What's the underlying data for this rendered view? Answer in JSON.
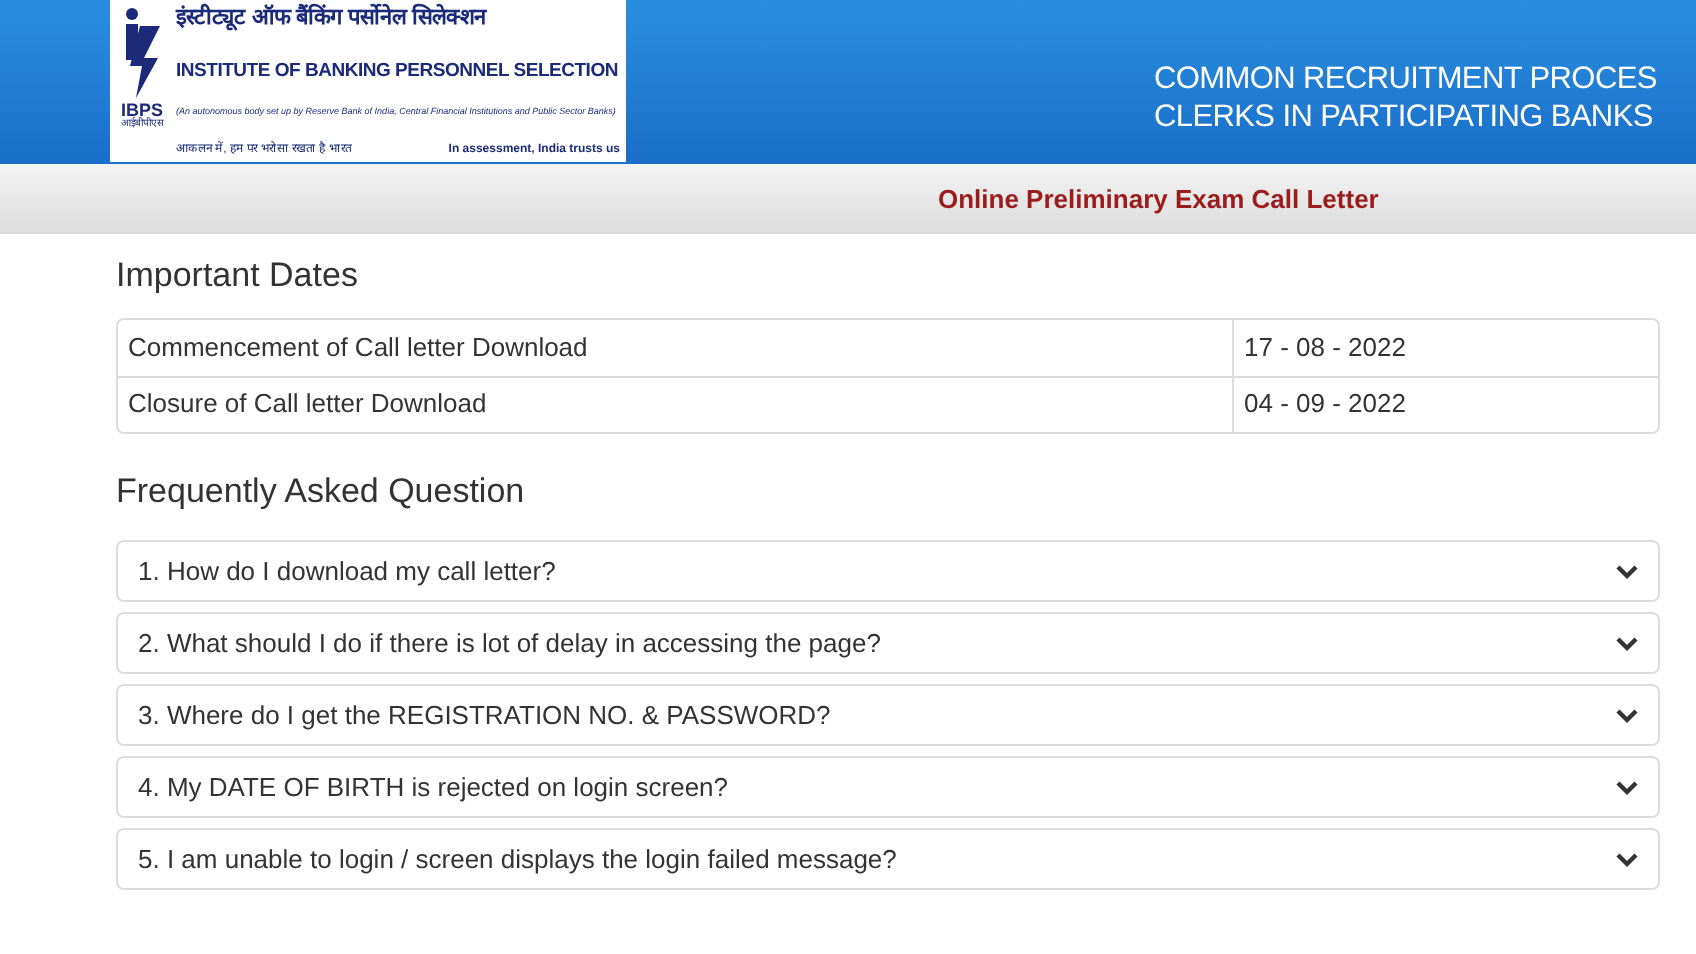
{
  "header": {
    "logo": {
      "mark": "IBPS",
      "mark_hindi": "आईबीपीएस",
      "title_hindi": "इंस्टीट्यूट ऑफ बैंकिंग पर्सोनेल सिलेक्शन",
      "title": "INSTITUTE OF BANKING PERSONNEL SELECTION",
      "subtitle": "(An autonomous body set up by Reserve Bank of India, Central Financial Institutions and Public Sector Banks)",
      "motto_hindi": "आकलन में, हम पर भरोसा रखता है भारत",
      "motto": "In assessment, India trusts us"
    },
    "title_lines": [
      "COMMON RECRUITMENT PROCES",
      "CLERKS IN PARTICIPATING BANKS"
    ]
  },
  "subheader": "Online Preliminary Exam Call Letter",
  "important_dates": {
    "heading": "Important Dates",
    "rows": [
      {
        "label": "Commencement of Call letter Download",
        "date": "17 - 08 - 2022"
      },
      {
        "label": "Closure of Call letter Download",
        "date": "04 - 09 - 2022"
      }
    ]
  },
  "faq": {
    "heading": "Frequently Asked Question",
    "items": [
      {
        "question": "1. How do I download my call letter?",
        "expanded": false
      },
      {
        "question": "2. What should I do if there is lot of delay in accessing the page?",
        "expanded": false
      },
      {
        "question": "3. Where do I get the REGISTRATION NO. & PASSWORD?",
        "expanded": false
      },
      {
        "question": "4. My DATE OF BIRTH is rejected on login screen?",
        "expanded": false
      },
      {
        "question": "5. I am unable to login / screen displays the login failed message?",
        "expanded": false
      }
    ]
  }
}
